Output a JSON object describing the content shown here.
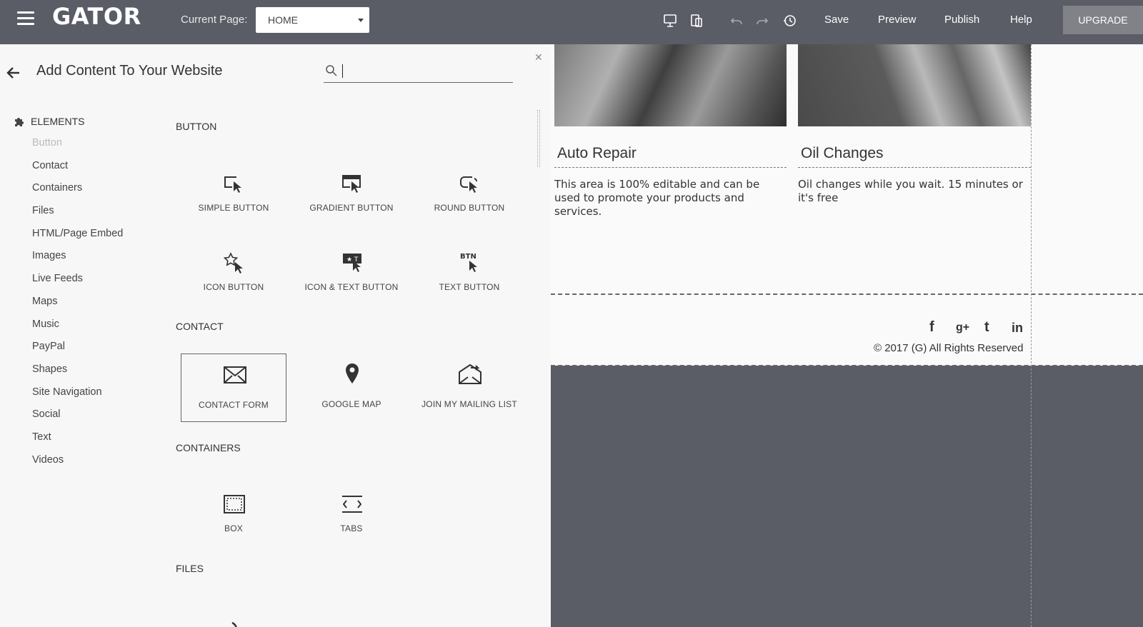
{
  "topbar": {
    "logo": "GATOR",
    "current_page_label": "Current Page:",
    "current_page_value": "HOME",
    "save": "Save",
    "preview": "Preview",
    "publish": "Publish",
    "help": "Help",
    "upgrade": "UPGRADE"
  },
  "panel": {
    "title": "Add Content To Your Website",
    "search_placeholder": "",
    "category_heading": "ELEMENTS",
    "categories": [
      "Button",
      "Contact",
      "Containers",
      "Files",
      "HTML/Page Embed",
      "Images",
      "Live Feeds",
      "Maps",
      "Music",
      "PayPal",
      "Shapes",
      "Site Navigation",
      "Social",
      "Text",
      "Videos"
    ],
    "sections": {
      "button": {
        "label": "BUTTON",
        "items": [
          "SIMPLE BUTTON",
          "GRADIENT BUTTON",
          "ROUND BUTTON",
          "ICON BUTTON",
          "ICON & TEXT BUTTON",
          "TEXT BUTTON"
        ]
      },
      "contact": {
        "label": "CONTACT",
        "items": [
          "CONTACT FORM",
          "GOOGLE MAP",
          "JOIN MY MAILING LIST"
        ]
      },
      "containers": {
        "label": "CONTAINERS",
        "items": [
          "BOX",
          "TABS"
        ]
      },
      "files": {
        "label": "FILES"
      }
    },
    "btn_icon_text": "BTN"
  },
  "site": {
    "card1_title": "Auto Repair",
    "card1_text": "This area is 100% editable and can be used to promote your products and services.",
    "card2_title": "Oil Changes",
    "card2_text": "Oil changes while you wait. 15 minutes or it's free",
    "social": [
      "f",
      "g+",
      "t",
      "in"
    ],
    "copyright": "© 2017  (G)  All Rights Reserved"
  },
  "colors": {
    "chrome": "#5a5c66",
    "panel_bg": "#f7f7f7",
    "upgrade_bg": "#808287"
  }
}
